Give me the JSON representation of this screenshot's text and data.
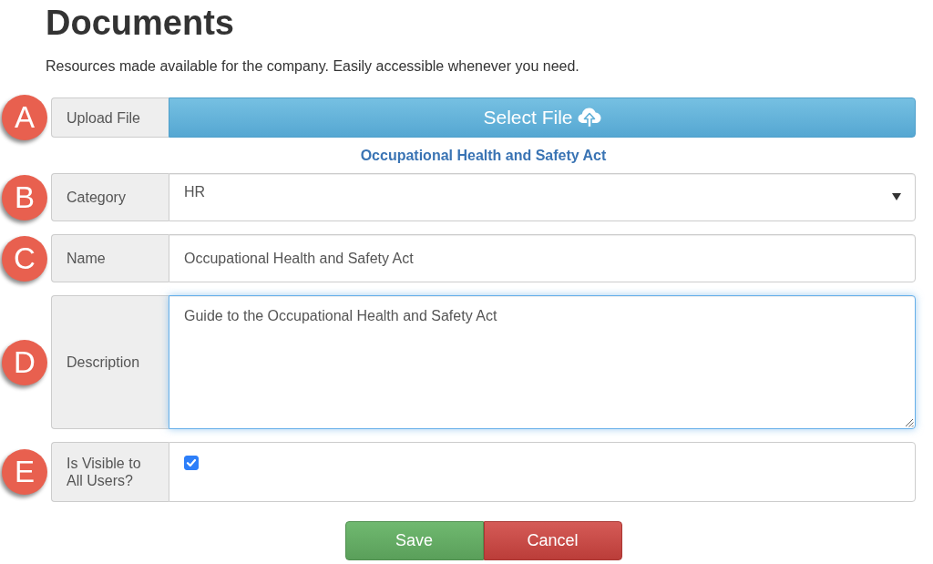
{
  "header": {
    "title": "Documents",
    "subtitle": "Resources made available for the company. Easily accessible whenever you need."
  },
  "form": {
    "fields": [
      {
        "kind": "upload",
        "marker": "A",
        "label": "Upload File",
        "button": "Select File",
        "file_name": "Occupational Health and Safety Act"
      },
      {
        "kind": "select",
        "marker": "B",
        "label": "Category",
        "value": "HR",
        "focused": false
      },
      {
        "kind": "text",
        "marker": "C",
        "label": "Name",
        "value": "Occupational Health and Safety Act",
        "focused": false
      },
      {
        "kind": "textarea",
        "marker": "D",
        "label": "Description",
        "value": "Guide to the Occupational Health and Safety Act",
        "focused": true
      },
      {
        "kind": "checkbox",
        "marker": "E",
        "label": "Is Visible to All Users?",
        "checked": true
      }
    ],
    "buttons": [
      {
        "kind": "save",
        "label": "Save"
      },
      {
        "kind": "cancel",
        "label": "Cancel"
      }
    ]
  }
}
